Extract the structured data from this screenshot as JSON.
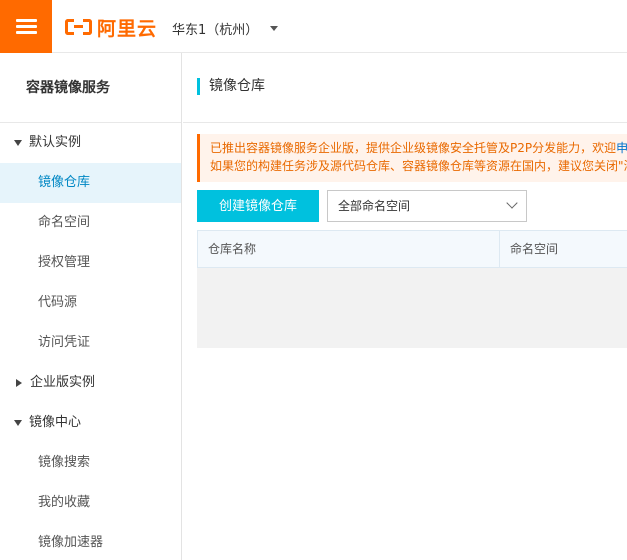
{
  "header": {
    "logo_text": "阿里云",
    "region": "华东1（杭州）"
  },
  "sidebar": {
    "title": "容器镜像服务",
    "groups": [
      {
        "label": "默认实例",
        "expanded": true,
        "items": [
          "镜像仓库",
          "命名空间",
          "授权管理",
          "代码源",
          "访问凭证"
        ]
      },
      {
        "label": "企业版实例",
        "expanded": false,
        "items": []
      },
      {
        "label": "镜像中心",
        "expanded": true,
        "items": [
          "镜像搜索",
          "我的收藏",
          "镜像加速器"
        ]
      }
    ],
    "active_item": "镜像仓库"
  },
  "main": {
    "title": "镜像仓库",
    "notice": {
      "line1": "已推出容器镜像服务企业版，提供企业级镜像安全托管及P2P分发能力，欢迎",
      "line1_link": "申",
      "line2": "如果您的构建任务涉及源代码仓库、容器镜像仓库等资源在国内，建议您关闭\"海"
    },
    "create_button": "创建镜像仓库",
    "namespace_select": {
      "selected": "全部命名空间"
    },
    "table": {
      "columns": [
        "仓库名称",
        "命名空间"
      ],
      "rows": []
    }
  },
  "colors": {
    "brand": "#ff6a00",
    "accent": "#00c1de",
    "active_bg": "#e6f4fb",
    "active_text": "#0087c4",
    "notice_bg": "#fff3eb",
    "notice_text": "#e96900"
  },
  "icons": {
    "menu": "hamburger-icon",
    "logo": "aliyun-logo",
    "region_caret": "caret-down-icon",
    "group_expanded": "triangle-down-icon",
    "group_collapsed": "triangle-right-icon",
    "select_chevron": "chevron-down-icon"
  }
}
